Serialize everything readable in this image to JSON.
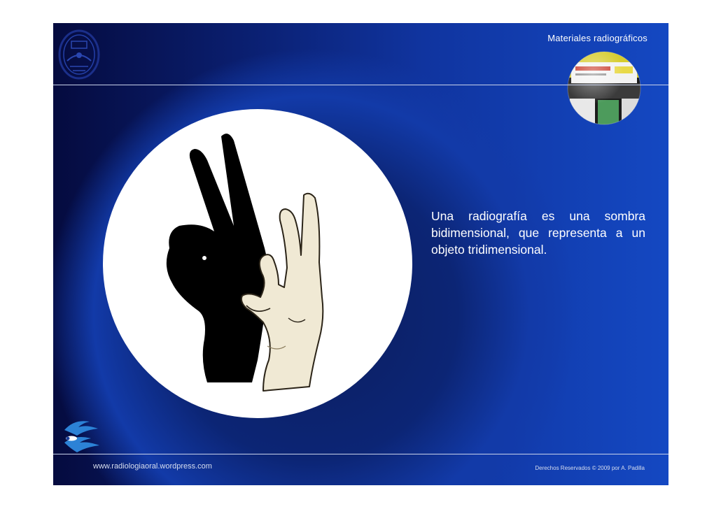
{
  "header": {
    "title": "Materiales radiográficos"
  },
  "main": {
    "text": "Una radiografía es  una sombra bidimensional,  que  representa a un objeto tridimensional."
  },
  "footer": {
    "url": "www.radiologiaoral.wordpress.com",
    "copyright": "Derechos Reservados © 2009 por A. Padilla"
  },
  "icons": {
    "top_left": "university-seal-icon",
    "top_right": "radiographic-film-box-globe-icon",
    "bottom_left": "wave-logo-icon",
    "illustration": "hand-shadow-rabbit-illustration"
  },
  "colors": {
    "background_dark": "#050b3f",
    "background_light": "#1448c2",
    "text": "#ffffff",
    "divider": "#c9d2ea"
  }
}
